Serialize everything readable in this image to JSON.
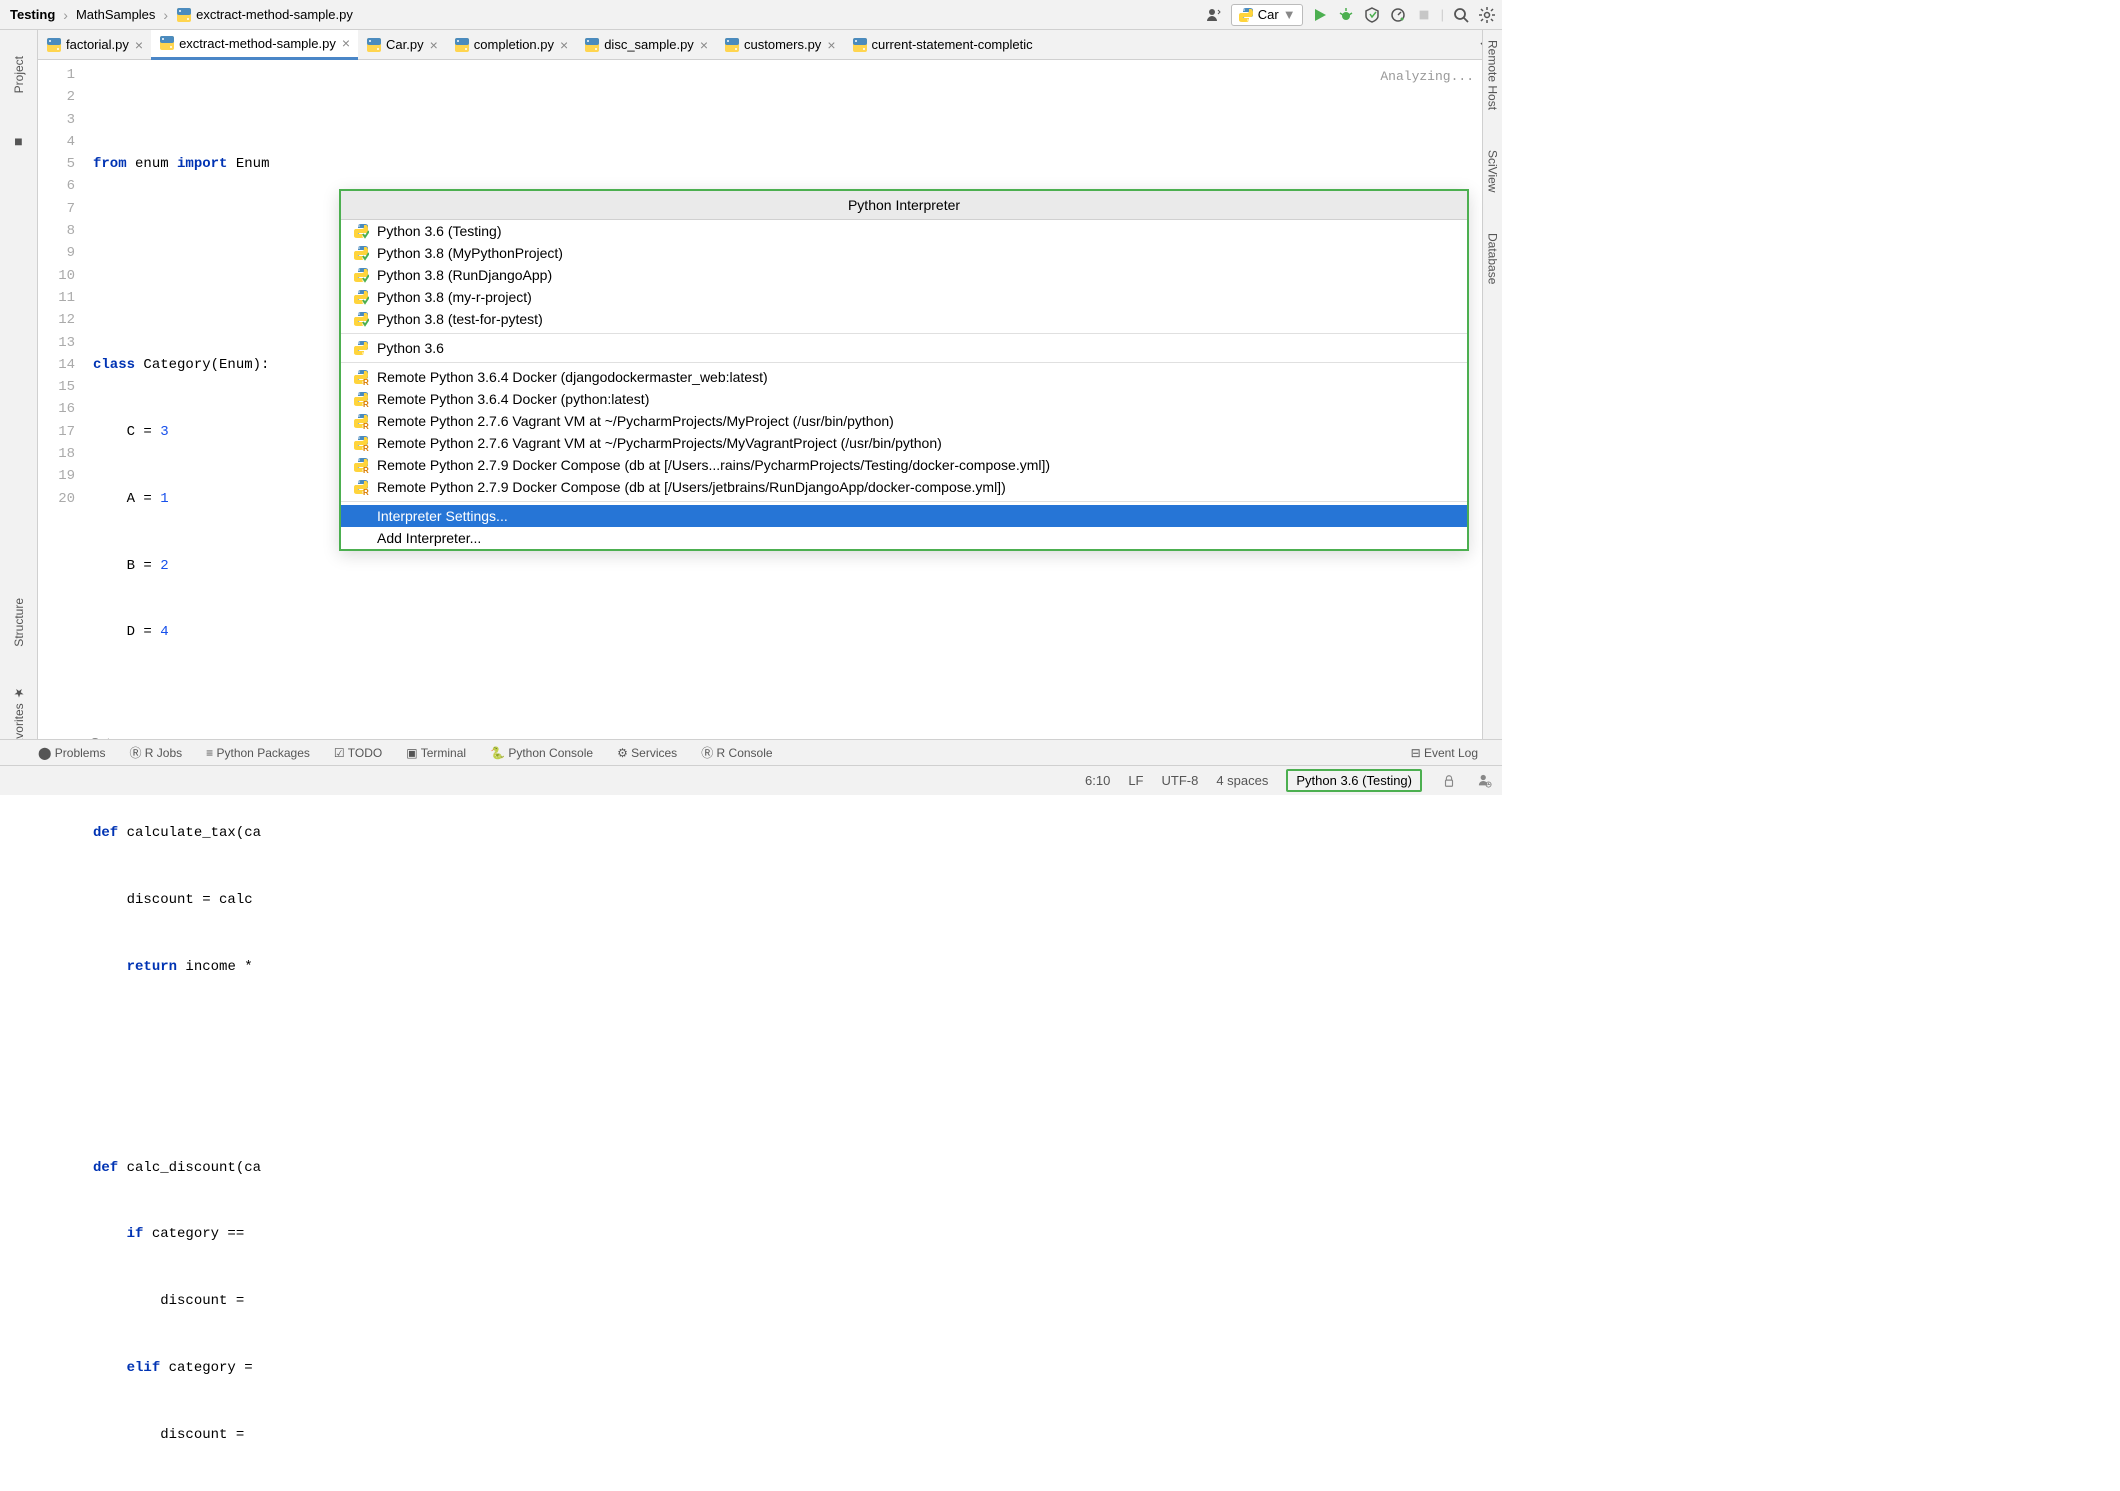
{
  "breadcrumbs": {
    "root": "Testing",
    "folder": "MathSamples",
    "file": "exctract-method-sample.py"
  },
  "run_config": "Car",
  "tabs": [
    {
      "label": "factorial.py",
      "active": false
    },
    {
      "label": "exctract-method-sample.py",
      "active": true
    },
    {
      "label": "Car.py",
      "active": false
    },
    {
      "label": "completion.py",
      "active": false
    },
    {
      "label": "disc_sample.py",
      "active": false
    },
    {
      "label": "customers.py",
      "active": false
    },
    {
      "label": "current-statement-completic",
      "active": false
    }
  ],
  "analyzing": "Analyzing...",
  "code": {
    "lines": 20,
    "l1a": "from",
    "l1b": "enum",
    "l1c": "import",
    "l1d": "Enum",
    "l4a": "class",
    "l4b": "Category(Enum):",
    "l5": "    C = ",
    "l5n": "3",
    "l6": "    A = ",
    "l6n": "1",
    "l7": "    B = ",
    "l7n": "2",
    "l8": "    D = ",
    "l8n": "4",
    "l11a": "def",
    "l11b": " calculate_tax(ca",
    "l12": "    discount = calc",
    "l13a": "    ",
    "l13b": "return",
    "l13c": " income *",
    "l16a": "def",
    "l16b": " calc_discount(ca",
    "l17a": "    ",
    "l17b": "if",
    "l17c": " category == ",
    "l18": "        discount = ",
    "l19a": "    ",
    "l19b": "elif",
    "l19c": " category =",
    "l20": "        discount = "
  },
  "editor_breadcrumb": "Category",
  "popup": {
    "title": "Python Interpreter",
    "groups": [
      [
        "Python 3.6 (Testing)",
        "Python 3.8 (MyPythonProject)",
        "Python 3.8 (RunDjangoApp)",
        "Python 3.8 (my-r-project)",
        "Python 3.8 (test-for-pytest)"
      ],
      [
        "Python 3.6"
      ],
      [
        "Remote Python 3.6.4 Docker (djangodockermaster_web:latest)",
        "Remote Python 3.6.4 Docker (python:latest)",
        "Remote Python 2.7.6 Vagrant VM at ~/PycharmProjects/MyProject (/usr/bin/python)",
        "Remote Python 2.7.6 Vagrant VM at ~/PycharmProjects/MyVagrantProject (/usr/bin/python)",
        "Remote Python 2.7.9 Docker Compose (db at [/Users...rains/PycharmProjects/Testing/docker-compose.yml])",
        "Remote Python 2.7.9 Docker Compose (db at [/Users/jetbrains/RunDjangoApp/docker-compose.yml])"
      ]
    ],
    "actions": [
      "Interpreter Settings...",
      "Add Interpreter..."
    ],
    "selected": "Interpreter Settings..."
  },
  "bottom_tools": [
    "Problems",
    "R Jobs",
    "Python Packages",
    "TODO",
    "Terminal",
    "Python Console",
    "Services",
    "R Console",
    "Event Log"
  ],
  "status": {
    "pos": "6:10",
    "line_end": "LF",
    "encoding": "UTF-8",
    "indent": "4 spaces",
    "interpreter": "Python 3.6 (Testing)"
  },
  "left_tools": [
    "Project",
    "Structure",
    "Favorites"
  ],
  "right_tools": [
    "Remote Host",
    "SciView",
    "Database"
  ]
}
